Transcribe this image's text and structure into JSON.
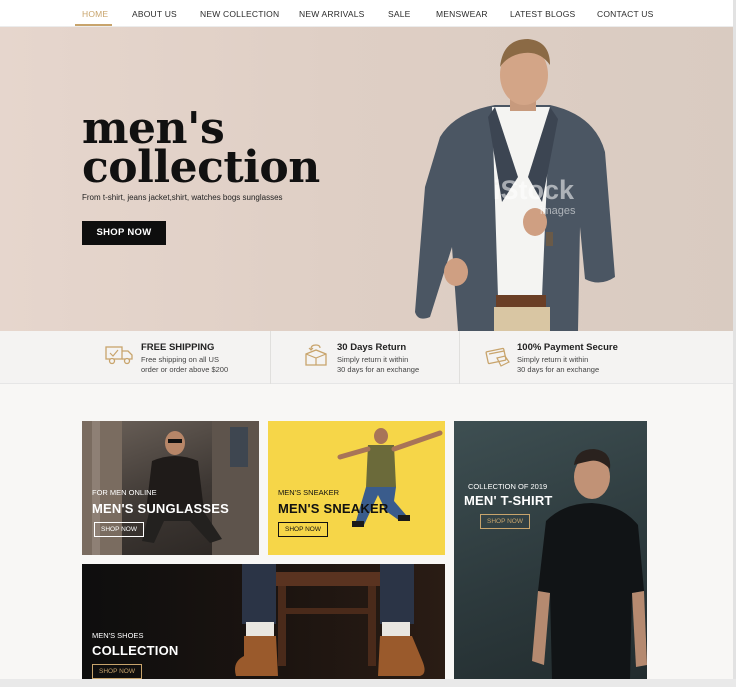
{
  "nav": {
    "items": [
      {
        "label": "HOME"
      },
      {
        "label": "ABOUT US"
      },
      {
        "label": "NEW COLLECTION"
      },
      {
        "label": "NEW ARRIVALS"
      },
      {
        "label": "SALE"
      },
      {
        "label": "MENSWEAR"
      },
      {
        "label": "LATEST BLOGS"
      },
      {
        "label": "CONTACT US"
      }
    ],
    "active_index": 0,
    "accent_color": "#c8a46c"
  },
  "hero": {
    "title_line1": "men's",
    "title_line2": "collection",
    "subtitle": "From t-shirt, jeans jacket,shirt, watches bogs sunglasses",
    "button_label": "SHOP NOW",
    "watermark": "iStock",
    "watermark_sub": "images"
  },
  "features": [
    {
      "icon": "delivery-truck-icon",
      "title": "FREE SHIPPING",
      "line1": "Free shipping on all US",
      "line2": "order or order above $200"
    },
    {
      "icon": "return-box-icon",
      "title": "30 Days Return",
      "line1": "Simply return it within",
      "line2": "30 days for an exchange"
    },
    {
      "icon": "secure-payment-icon",
      "title": "100% Payment Secure",
      "line1": "Simply return it within",
      "line2": "30 days for an exchange"
    }
  ],
  "cards": {
    "sunglasses": {
      "kicker": "FOR MEN ONLINE",
      "title": "MEN'S SUNGLASSES",
      "button": "SHOP NOW"
    },
    "sneaker": {
      "kicker": "MEN'S SNEAKER",
      "title": "MEN'S SNEAKER",
      "button": "SHOP NOW"
    },
    "tshirt": {
      "kicker": "COLLECTION OF 2019",
      "title": "MEN' T-SHIRT",
      "button": "SHOP NOW"
    },
    "shoes": {
      "kicker": "MEN'S SHOES",
      "title": "COLLECTION",
      "button": "SHOP NOW"
    }
  },
  "colors": {
    "hero_bg": "#e2d3ca",
    "sneaker_bg": "#f6d648",
    "dark_button": "#0e0e0e"
  }
}
